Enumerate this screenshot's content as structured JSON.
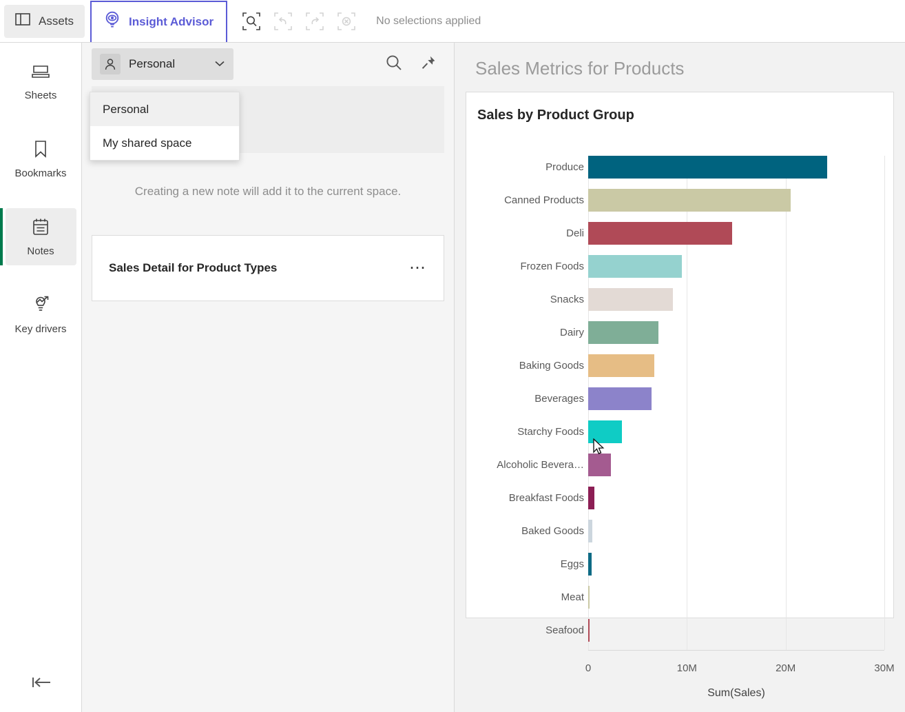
{
  "topbar": {
    "assets_label": "Assets",
    "insight_advisor_label": "Insight Advisor",
    "selection_status": "No selections applied",
    "icons": {
      "assets": "panel-icon",
      "insight_advisor": "lightbulb-eye-icon",
      "search_selections": "selection-search-icon",
      "undo": "undo-icon",
      "redo": "redo-icon",
      "clear_all": "clear-selections-icon"
    }
  },
  "sidebar": {
    "items": [
      {
        "label": "Sheets",
        "icon": "sheets-icon",
        "active": false
      },
      {
        "label": "Bookmarks",
        "icon": "bookmark-icon",
        "active": false
      },
      {
        "label": "Notes",
        "icon": "notes-icon",
        "active": true
      },
      {
        "label": "Key drivers",
        "icon": "key-drivers-icon",
        "active": false
      }
    ],
    "collapse_icon": "collapse-left-icon",
    "active_accent": "#007a4d"
  },
  "notes_panel": {
    "space_selector": {
      "value": "Personal",
      "avatar_icon": "user-icon",
      "chevron_icon": "chevron-down-icon"
    },
    "search_icon": "search-icon",
    "pin_icon": "pin-icon",
    "dropdown": {
      "open": true,
      "options": [
        {
          "label": "Personal",
          "selected": true
        },
        {
          "label": "My shared space",
          "selected": false
        }
      ]
    },
    "hint": "Creating a new note will add it to the current space.",
    "note_cards": [
      {
        "title": "Sales Detail for Product Types",
        "more_icon": "more-options-icon"
      }
    ]
  },
  "main": {
    "title": "Sales Metrics for Products"
  },
  "chart_data": {
    "type": "bar",
    "orientation": "horizontal",
    "title": "Sales by Product Group",
    "xlabel": "Sum(Sales)",
    "ylabel": "",
    "xlim": [
      0,
      30000000
    ],
    "xticks": [
      "0",
      "10M",
      "20M",
      "30M"
    ],
    "xtick_values": [
      0,
      10000000,
      20000000,
      30000000
    ],
    "grid": true,
    "legend": "none",
    "categories": [
      "Produce",
      "Canned Products",
      "Deli",
      "Frozen Foods",
      "Snacks",
      "Dairy",
      "Baking Goods",
      "Beverages",
      "Starchy Foods",
      "Alcoholic Bevera…",
      "Breakfast Foods",
      "Baked Goods",
      "Eggs",
      "Meat",
      "Seafood"
    ],
    "values": [
      24200000,
      20500000,
      14600000,
      9500000,
      8600000,
      7100000,
      6700000,
      6400000,
      3450000,
      2300000,
      620000,
      440000,
      360000,
      110000,
      90000
    ],
    "colors": [
      "#00637f",
      "#cac9a5",
      "#b04a57",
      "#95d2cf",
      "#e3dad5",
      "#7fae97",
      "#e6bd85",
      "#8c83ca",
      "#0fccc5",
      "#a45b90",
      "#8c1e54",
      "#ccd6de",
      "#0e6b85",
      "#cac9a5",
      "#b04a57"
    ]
  }
}
